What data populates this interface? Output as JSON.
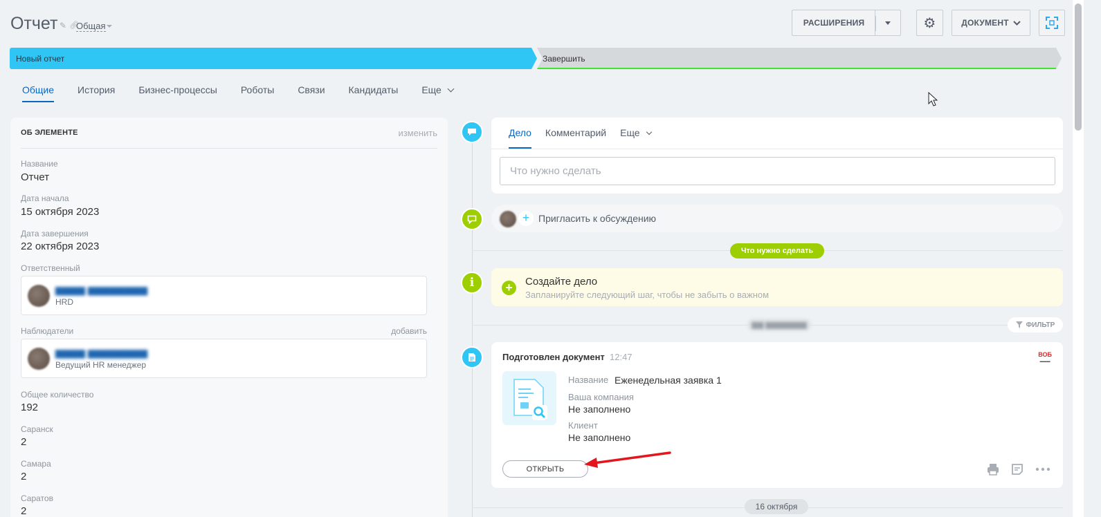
{
  "header": {
    "title": "Отчет",
    "category": "Общая",
    "extensions_label": "РАСШИРЕНИЯ",
    "document_label": "ДОКУМЕНТ"
  },
  "stages": {
    "current": "Новый отчет",
    "next": "Завершить"
  },
  "tabs": [
    "Общие",
    "История",
    "Бизнес-процессы",
    "Роботы",
    "Связи",
    "Кандидаты",
    "Еще"
  ],
  "about": {
    "title": "ОБ ЭЛЕМЕНТЕ",
    "edit": "изменить",
    "fields": {
      "name_label": "Название",
      "name_value": "Отчет",
      "start_label": "Дата начала",
      "start_value": "15 октября 2023",
      "end_label": "Дата завершения",
      "end_value": "22 октября 2023",
      "responsible_label": "Ответственный",
      "responsible_role": "HRD",
      "observers_label": "Наблюдатели",
      "observers_add": "добавить",
      "observer_role": "Ведущий HR менеджер",
      "total_label": "Общее количество",
      "total_value": "192",
      "saransk_label": "Саранск",
      "saransk_value": "2",
      "samara_label": "Самара",
      "samara_value": "2",
      "saratov_label": "Саратов",
      "saratov_value": "2"
    }
  },
  "composer": {
    "tabs": [
      "Дело",
      "Комментарий",
      "Еще"
    ],
    "placeholder": "Что нужно сделать"
  },
  "invite": {
    "label": "Пригласить к обсуждению"
  },
  "todo_badge": "Что нужно сделать",
  "create": {
    "title": "Создайте дело",
    "subtitle": "Запланируйте следующий шаг, чтобы не забыть о важном"
  },
  "filter_label": "ФИЛЬТР",
  "document": {
    "title": "Подготовлен документ",
    "time": "12:47",
    "name_label": "Название",
    "name_value": "Еженедельная заявка 1",
    "company_label": "Ваша компания",
    "company_value": "Не заполнено",
    "client_label": "Клиент",
    "client_value": "Не заполнено",
    "open_label": "ОТКРЫТЬ"
  },
  "date_badge": "16 октября",
  "colors": {
    "accent": "#2fc6f6",
    "link": "#0b66c3",
    "success": "#9dcf00",
    "stage_done_line": "#3ee62b",
    "arrow": "#e3161d"
  }
}
